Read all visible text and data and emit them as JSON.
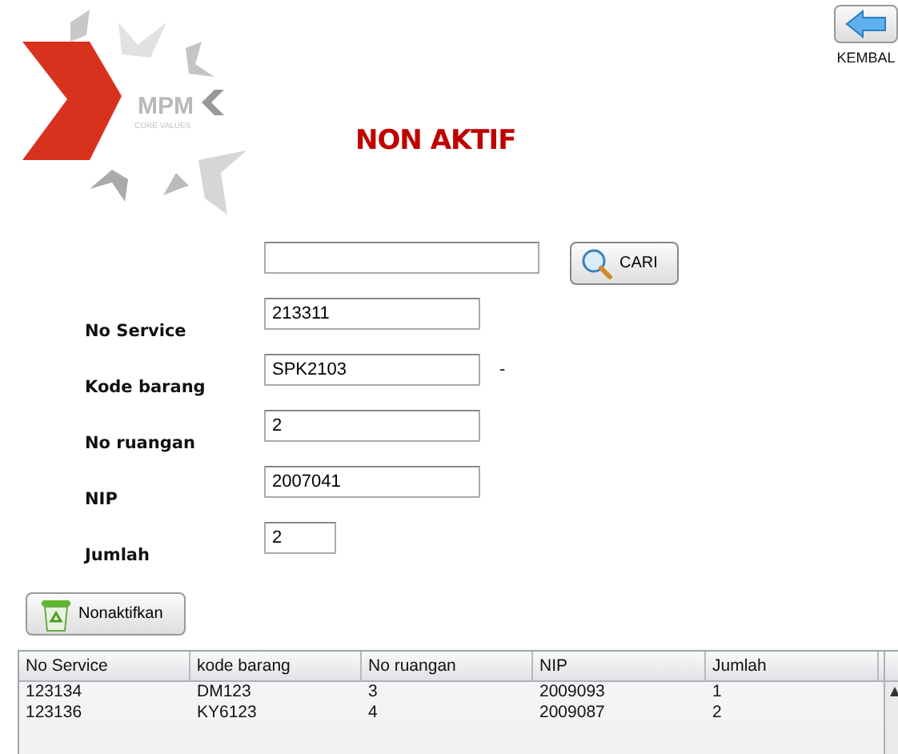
{
  "logo": {
    "name": "MPM",
    "tagline": "CORE VALUES"
  },
  "title": "NON AKTIF",
  "back_button": {
    "label": "KEMBAL"
  },
  "search": {
    "button": "CARI"
  },
  "form": [
    {
      "label": "No Service",
      "value": "213311",
      "kind": "long"
    },
    {
      "label": "Kode barang",
      "value": "SPK2103",
      "kind": "long",
      "suffix": "-"
    },
    {
      "label": "No ruangan",
      "value": "2",
      "kind": "long"
    },
    {
      "label": "NIP",
      "value": "2007041",
      "kind": "long"
    },
    {
      "label": "Jumlah",
      "value": "2",
      "kind": "short"
    }
  ],
  "action_button": {
    "label": "Nonaktifkan"
  },
  "table": {
    "columns": [
      "No Service",
      "kode barang",
      "No ruangan",
      "NIP",
      "Jumlah"
    ],
    "rows": [
      [
        "123134",
        "DM123",
        "3",
        "2009093",
        "1"
      ],
      [
        "123136",
        "KY6123",
        "4",
        "2009087",
        "2"
      ]
    ]
  }
}
